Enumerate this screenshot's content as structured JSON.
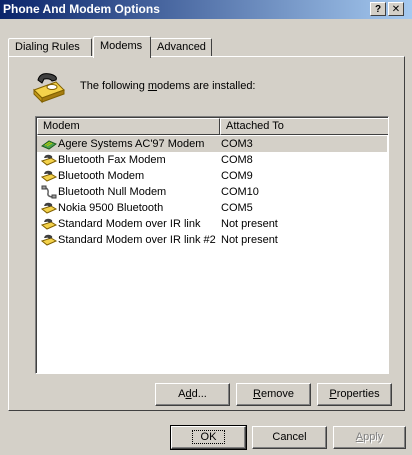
{
  "window": {
    "title": "Phone And Modem Options",
    "help_label": "?",
    "close_label": "✕"
  },
  "tabs": [
    {
      "label": "Dialing Rules"
    },
    {
      "label": "Modems"
    },
    {
      "label": "Advanced"
    }
  ],
  "intro": {
    "pre": "The following ",
    "accel": "m",
    "post": "odems are  installed:"
  },
  "list": {
    "columns": [
      "Modem",
      "Attached To"
    ],
    "rows": [
      {
        "name": "Agere Systems AC'97 Modem",
        "attached": "COM3",
        "icon": "internal-modem-icon"
      },
      {
        "name": "Bluetooth Fax Modem",
        "attached": "COM8",
        "icon": "phone-modem-icon"
      },
      {
        "name": "Bluetooth Modem",
        "attached": "COM9",
        "icon": "phone-modem-icon"
      },
      {
        "name": "Bluetooth Null Modem",
        "attached": "COM10",
        "icon": "null-modem-cable-icon"
      },
      {
        "name": "Nokia 9500 Bluetooth",
        "attached": "COM5",
        "icon": "phone-modem-icon"
      },
      {
        "name": "Standard Modem over IR link",
        "attached": "Not present",
        "icon": "phone-modem-icon"
      },
      {
        "name": "Standard Modem over IR link #2",
        "attached": "Not present",
        "icon": "phone-modem-icon"
      }
    ]
  },
  "buttons": {
    "add": {
      "pre": "A",
      "accel": "d",
      "post": "d..."
    },
    "remove": {
      "accel": "R",
      "post": "emove"
    },
    "properties": {
      "accel": "P",
      "post": "roperties"
    },
    "ok": "OK",
    "cancel": "Cancel",
    "apply": {
      "accel": "A",
      "post": "pply"
    }
  }
}
